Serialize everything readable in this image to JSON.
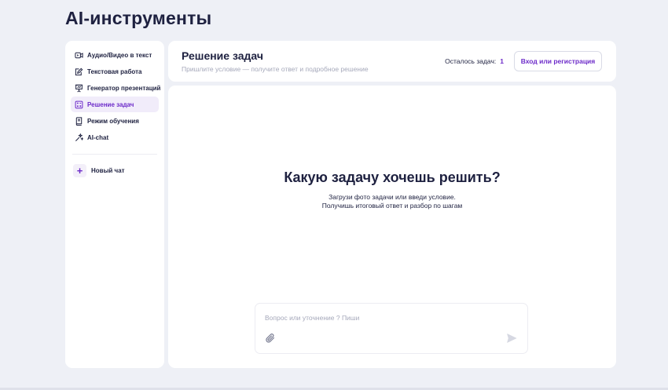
{
  "page": {
    "title": "AI-инструменты"
  },
  "sidebar": {
    "items": [
      {
        "label": "Аудио/Видео в текст",
        "icon": "video-icon",
        "active": false
      },
      {
        "label": "Текстовая работа",
        "icon": "edit-document-icon",
        "active": false
      },
      {
        "label": "Генератор презентаций",
        "icon": "presentation-icon",
        "active": false
      },
      {
        "label": "Решение задач",
        "icon": "calculator-icon",
        "active": true
      },
      {
        "label": "Режим обучения",
        "icon": "book-icon",
        "active": false
      },
      {
        "label": "AI-chat",
        "icon": "sparkle-icon",
        "active": false
      }
    ],
    "new_chat": {
      "label": "Новый чат",
      "icon": "plus-icon"
    }
  },
  "header": {
    "title": "Решение задач",
    "subtitle": "Пришлите условие — получите ответ и подробное решение",
    "remaining_label": "Осталось задач:",
    "remaining_count": "1",
    "login_label": "Вход или регистрация"
  },
  "main": {
    "heading": "Какую задачу хочешь решить?",
    "line1": "Загрузи фото задачи или введи условие.",
    "line2": "Получишь итоговый ответ и разбор по шагам"
  },
  "composer": {
    "placeholder": "Вопрос или уточнение ? Пиши",
    "value": "",
    "attach_icon": "paperclip-icon",
    "send_icon": "send-icon"
  },
  "colors": {
    "accent": "#6d2bc9",
    "background": "#eef0f6",
    "text": "#1e2140",
    "muted": "#a5a8ba"
  }
}
